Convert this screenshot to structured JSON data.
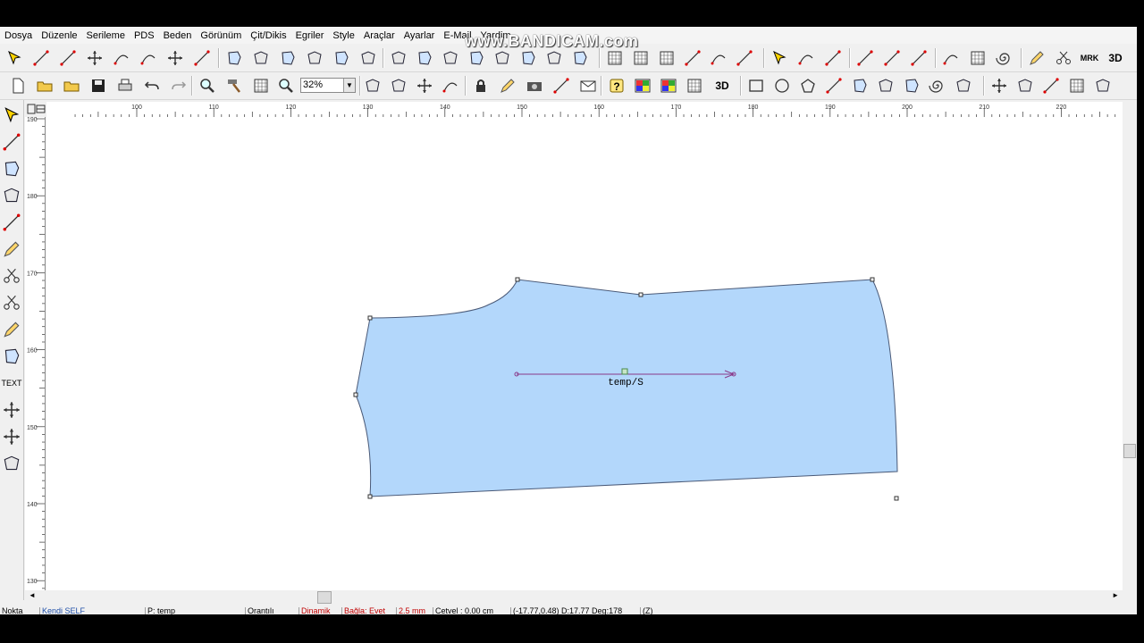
{
  "menu": [
    "Dosya",
    "Düzenle",
    "Serileme",
    "PDS",
    "Beden",
    "Görünüm",
    "Çit/Dikis",
    "Egriler",
    "Style",
    "Araçlar",
    "Ayarlar",
    "E-Mail",
    "Yardim"
  ],
  "watermark": "www.BANDICAM.com",
  "toolbar": {
    "zoom_value": "32%",
    "label_3d_top": "3D",
    "label_3d_bottom": "3D",
    "label_mrk": "MRK"
  },
  "left_toolbar": {
    "text_label": "TEXT"
  },
  "ruler": {
    "top_ticks": [
      "100",
      "110",
      "120",
      "130",
      "140",
      "150",
      "160",
      "170",
      "180",
      "190",
      "200",
      "210",
      "220"
    ],
    "left_ticks": [
      "190",
      "180",
      "170",
      "160",
      "150",
      "140",
      "130"
    ]
  },
  "piece": {
    "fill": "#b3d7fb",
    "label": "temp/S"
  },
  "statusbar": {
    "mode": "Nokta",
    "piece_name": "Kendi SELF",
    "p_label": "P: temp",
    "ratio": "Orantılı",
    "dynamic": "Dinamik",
    "link": "Bağla: Evet",
    "step": "2.5 mm",
    "ruler": "Cetvel : 0.00 cm",
    "coords": "(-17.77,0.48) D:17.77 Deg:178",
    "z": "(Z)"
  },
  "colors": {
    "accent_red": "#c00000",
    "piece_stroke": "#4a5a78"
  }
}
